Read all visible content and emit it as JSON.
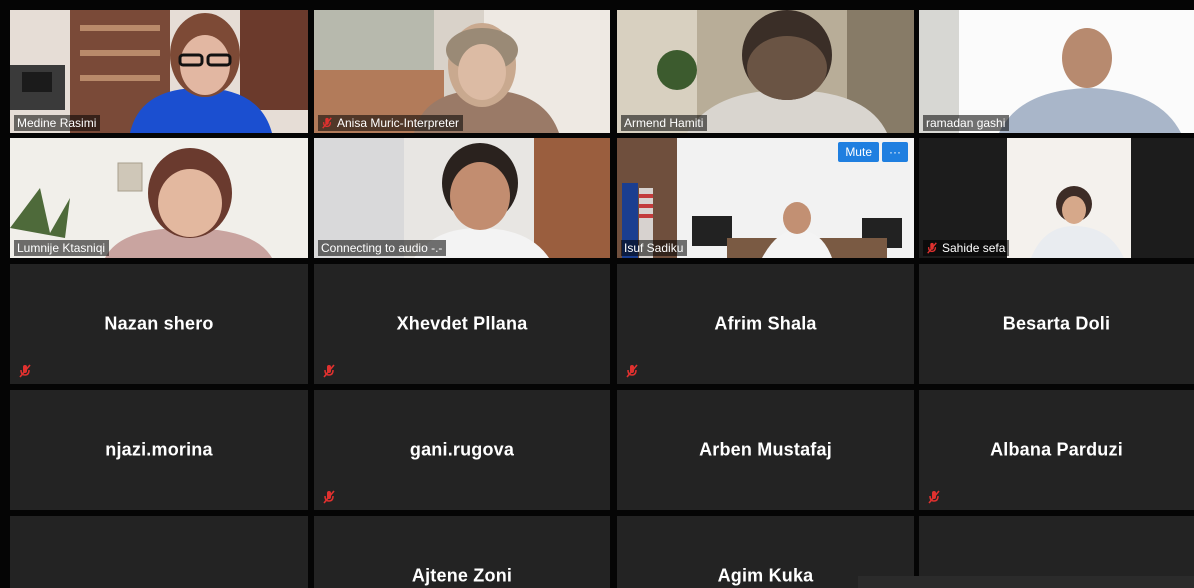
{
  "video_tiles": [
    {
      "name": "Medine Rasimi",
      "muted": false
    },
    {
      "name": "Anisa Muric-Interpreter",
      "muted": true
    },
    {
      "name": "Armend Hamiti",
      "muted": false
    },
    {
      "name": "ramadan gashi",
      "muted": false,
      "active_speaker": true
    },
    {
      "name": "Lumnije Ktasniqi",
      "muted": false
    },
    {
      "name": "Connecting to audio -.-",
      "muted": false
    },
    {
      "name": "Isuf Sadiku",
      "muted": false,
      "controls": {
        "mute_label": "Mute",
        "more_label": "···"
      }
    },
    {
      "name": "Sahide sefa",
      "muted": true
    }
  ],
  "name_tiles": [
    {
      "name": "Nazan shero",
      "muted": true
    },
    {
      "name": "Xhevdet Pllana",
      "muted": true
    },
    {
      "name": "Afrim Shala",
      "muted": true
    },
    {
      "name": "Besarta Doli",
      "muted": false
    },
    {
      "name": "njazi.morina",
      "muted": false
    },
    {
      "name": "gani.rugova",
      "muted": true
    },
    {
      "name": "Arben Mustafaj",
      "muted": false
    },
    {
      "name": "Albana Parduzi",
      "muted": true
    },
    {
      "name": "",
      "muted": false
    },
    {
      "name": "Ajtene Zoni",
      "muted": false
    },
    {
      "name": "Agim Kuka",
      "muted": false
    },
    {
      "name": "",
      "muted": false
    }
  ],
  "colors": {
    "active_speaker_border": "#c9e35a",
    "mute_icon": "#e0312f",
    "control_blue": "#1f7fe0"
  }
}
